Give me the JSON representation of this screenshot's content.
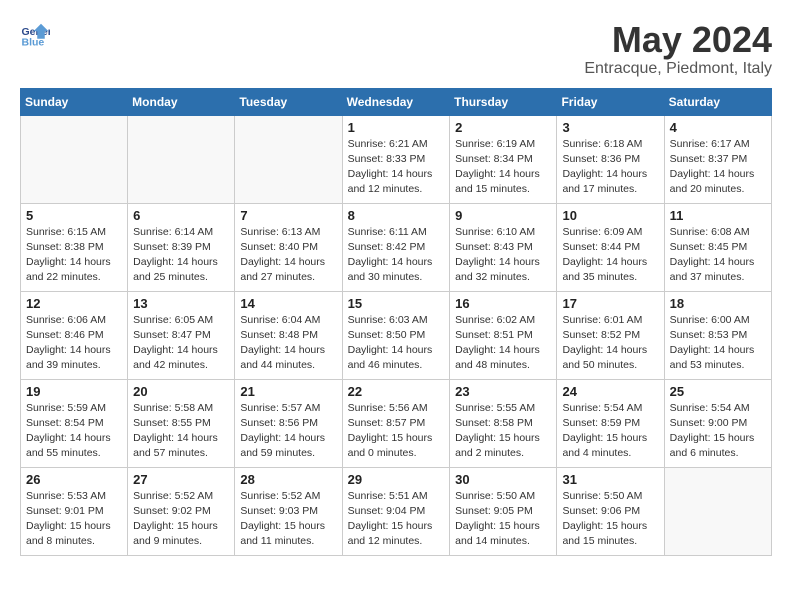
{
  "header": {
    "logo_line1": "General",
    "logo_line2": "Blue",
    "month_title": "May 2024",
    "subtitle": "Entracque, Piedmont, Italy"
  },
  "days_of_week": [
    "Sunday",
    "Monday",
    "Tuesday",
    "Wednesday",
    "Thursday",
    "Friday",
    "Saturday"
  ],
  "weeks": [
    [
      {
        "day": "",
        "info": ""
      },
      {
        "day": "",
        "info": ""
      },
      {
        "day": "",
        "info": ""
      },
      {
        "day": "1",
        "info": "Sunrise: 6:21 AM\nSunset: 8:33 PM\nDaylight: 14 hours\nand 12 minutes."
      },
      {
        "day": "2",
        "info": "Sunrise: 6:19 AM\nSunset: 8:34 PM\nDaylight: 14 hours\nand 15 minutes."
      },
      {
        "day": "3",
        "info": "Sunrise: 6:18 AM\nSunset: 8:36 PM\nDaylight: 14 hours\nand 17 minutes."
      },
      {
        "day": "4",
        "info": "Sunrise: 6:17 AM\nSunset: 8:37 PM\nDaylight: 14 hours\nand 20 minutes."
      }
    ],
    [
      {
        "day": "5",
        "info": "Sunrise: 6:15 AM\nSunset: 8:38 PM\nDaylight: 14 hours\nand 22 minutes."
      },
      {
        "day": "6",
        "info": "Sunrise: 6:14 AM\nSunset: 8:39 PM\nDaylight: 14 hours\nand 25 minutes."
      },
      {
        "day": "7",
        "info": "Sunrise: 6:13 AM\nSunset: 8:40 PM\nDaylight: 14 hours\nand 27 minutes."
      },
      {
        "day": "8",
        "info": "Sunrise: 6:11 AM\nSunset: 8:42 PM\nDaylight: 14 hours\nand 30 minutes."
      },
      {
        "day": "9",
        "info": "Sunrise: 6:10 AM\nSunset: 8:43 PM\nDaylight: 14 hours\nand 32 minutes."
      },
      {
        "day": "10",
        "info": "Sunrise: 6:09 AM\nSunset: 8:44 PM\nDaylight: 14 hours\nand 35 minutes."
      },
      {
        "day": "11",
        "info": "Sunrise: 6:08 AM\nSunset: 8:45 PM\nDaylight: 14 hours\nand 37 minutes."
      }
    ],
    [
      {
        "day": "12",
        "info": "Sunrise: 6:06 AM\nSunset: 8:46 PM\nDaylight: 14 hours\nand 39 minutes."
      },
      {
        "day": "13",
        "info": "Sunrise: 6:05 AM\nSunset: 8:47 PM\nDaylight: 14 hours\nand 42 minutes."
      },
      {
        "day": "14",
        "info": "Sunrise: 6:04 AM\nSunset: 8:48 PM\nDaylight: 14 hours\nand 44 minutes."
      },
      {
        "day": "15",
        "info": "Sunrise: 6:03 AM\nSunset: 8:50 PM\nDaylight: 14 hours\nand 46 minutes."
      },
      {
        "day": "16",
        "info": "Sunrise: 6:02 AM\nSunset: 8:51 PM\nDaylight: 14 hours\nand 48 minutes."
      },
      {
        "day": "17",
        "info": "Sunrise: 6:01 AM\nSunset: 8:52 PM\nDaylight: 14 hours\nand 50 minutes."
      },
      {
        "day": "18",
        "info": "Sunrise: 6:00 AM\nSunset: 8:53 PM\nDaylight: 14 hours\nand 53 minutes."
      }
    ],
    [
      {
        "day": "19",
        "info": "Sunrise: 5:59 AM\nSunset: 8:54 PM\nDaylight: 14 hours\nand 55 minutes."
      },
      {
        "day": "20",
        "info": "Sunrise: 5:58 AM\nSunset: 8:55 PM\nDaylight: 14 hours\nand 57 minutes."
      },
      {
        "day": "21",
        "info": "Sunrise: 5:57 AM\nSunset: 8:56 PM\nDaylight: 14 hours\nand 59 minutes."
      },
      {
        "day": "22",
        "info": "Sunrise: 5:56 AM\nSunset: 8:57 PM\nDaylight: 15 hours\nand 0 minutes."
      },
      {
        "day": "23",
        "info": "Sunrise: 5:55 AM\nSunset: 8:58 PM\nDaylight: 15 hours\nand 2 minutes."
      },
      {
        "day": "24",
        "info": "Sunrise: 5:54 AM\nSunset: 8:59 PM\nDaylight: 15 hours\nand 4 minutes."
      },
      {
        "day": "25",
        "info": "Sunrise: 5:54 AM\nSunset: 9:00 PM\nDaylight: 15 hours\nand 6 minutes."
      }
    ],
    [
      {
        "day": "26",
        "info": "Sunrise: 5:53 AM\nSunset: 9:01 PM\nDaylight: 15 hours\nand 8 minutes."
      },
      {
        "day": "27",
        "info": "Sunrise: 5:52 AM\nSunset: 9:02 PM\nDaylight: 15 hours\nand 9 minutes."
      },
      {
        "day": "28",
        "info": "Sunrise: 5:52 AM\nSunset: 9:03 PM\nDaylight: 15 hours\nand 11 minutes."
      },
      {
        "day": "29",
        "info": "Sunrise: 5:51 AM\nSunset: 9:04 PM\nDaylight: 15 hours\nand 12 minutes."
      },
      {
        "day": "30",
        "info": "Sunrise: 5:50 AM\nSunset: 9:05 PM\nDaylight: 15 hours\nand 14 minutes."
      },
      {
        "day": "31",
        "info": "Sunrise: 5:50 AM\nSunset: 9:06 PM\nDaylight: 15 hours\nand 15 minutes."
      },
      {
        "day": "",
        "info": ""
      }
    ]
  ]
}
